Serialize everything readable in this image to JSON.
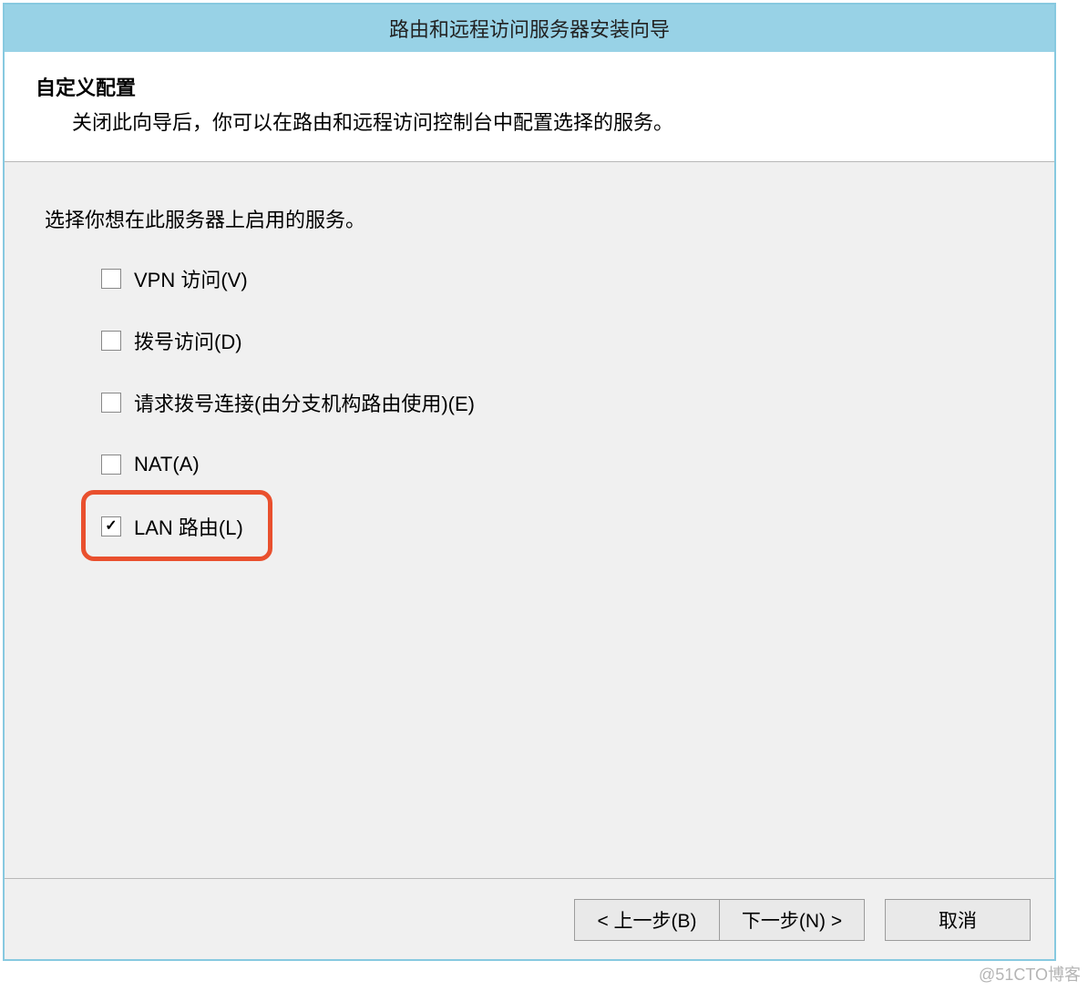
{
  "window": {
    "title": "路由和远程访问服务器安装向导"
  },
  "header": {
    "title": "自定义配置",
    "description": "关闭此向导后，你可以在路由和远程访问控制台中配置选择的服务。"
  },
  "body": {
    "instruction": "选择你想在此服务器上启用的服务。",
    "options": [
      {
        "label": "VPN 访问(V)",
        "checked": false
      },
      {
        "label": "拨号访问(D)",
        "checked": false
      },
      {
        "label": "请求拨号连接(由分支机构路由使用)(E)",
        "checked": false
      },
      {
        "label": "NAT(A)",
        "checked": false
      },
      {
        "label": "LAN 路由(L)",
        "checked": true,
        "highlighted": true
      }
    ]
  },
  "footer": {
    "back": "< 上一步(B)",
    "next": "下一步(N) >",
    "cancel": "取消"
  },
  "watermark": "@51CTO博客"
}
